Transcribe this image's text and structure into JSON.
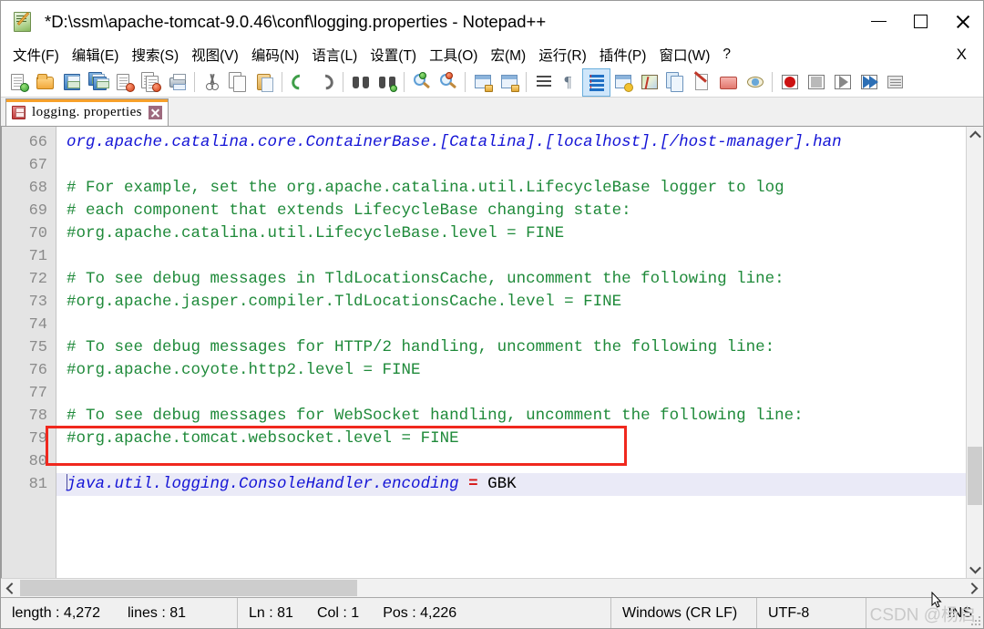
{
  "window": {
    "title": "*D:\\ssm\\apache-tomcat-9.0.46\\conf\\logging.properties - Notepad++",
    "app_icon": "notepad-plus-plus-icon",
    "controls": {
      "minimize": "minimize-icon",
      "maximize": "maximize-icon",
      "close": "close-icon"
    }
  },
  "menubar": {
    "items": [
      {
        "label": "文件(F)",
        "name": "menu-file"
      },
      {
        "label": "编辑(E)",
        "name": "menu-edit"
      },
      {
        "label": "搜索(S)",
        "name": "menu-search"
      },
      {
        "label": "视图(V)",
        "name": "menu-view"
      },
      {
        "label": "编码(N)",
        "name": "menu-encoding"
      },
      {
        "label": "语言(L)",
        "name": "menu-language"
      },
      {
        "label": "设置(T)",
        "name": "menu-settings"
      },
      {
        "label": "工具(O)",
        "name": "menu-tools"
      },
      {
        "label": "宏(M)",
        "name": "menu-macro"
      },
      {
        "label": "运行(R)",
        "name": "menu-run"
      },
      {
        "label": "插件(P)",
        "name": "menu-plugins"
      },
      {
        "label": "窗口(W)",
        "name": "menu-window"
      },
      {
        "label": "?",
        "name": "menu-help"
      }
    ],
    "close_doc_label": "X"
  },
  "toolbar": {
    "buttons": [
      "new-file-icon",
      "open-file-icon",
      "save-icon",
      "save-all-icon",
      "close-file-icon",
      "close-all-files-icon",
      "print-icon",
      "cut-icon",
      "copy-icon",
      "paste-icon",
      "undo-icon",
      "redo-icon",
      "find-icon",
      "replace-icon",
      "zoom-in-icon",
      "zoom-out-icon",
      "sync-vertical-scroll-icon",
      "sync-horizontal-scroll-icon",
      "word-wrap-icon",
      "show-all-characters-icon",
      "indent-guide-icon",
      "user-defined-language-icon",
      "document-map-icon",
      "function-list-icon",
      "folder-as-workspace-icon",
      "monitoring-icon",
      "macro-record-icon",
      "macro-stop-icon",
      "macro-play-icon",
      "macro-run-multiple-icon",
      "run-icon"
    ]
  },
  "tab": {
    "label": "logging. properties",
    "save_state_icon": "unsaved-floppy-icon",
    "close_icon": "tab-close-icon"
  },
  "editor": {
    "first_line": 66,
    "lines": [
      {
        "no": 66,
        "type": "key",
        "text": "org.apache.catalina.core.ContainerBase.[Catalina].[localhost].[/host-manager].han"
      },
      {
        "no": 67,
        "type": "blank",
        "text": ""
      },
      {
        "no": 68,
        "type": "comment",
        "text": "# For example, set the org.apache.catalina.util.LifecycleBase logger to log"
      },
      {
        "no": 69,
        "type": "comment",
        "text": "# each component that extends LifecycleBase changing state:"
      },
      {
        "no": 70,
        "type": "comment",
        "text": "#org.apache.catalina.util.LifecycleBase.level = FINE"
      },
      {
        "no": 71,
        "type": "blank",
        "text": ""
      },
      {
        "no": 72,
        "type": "comment",
        "text": "# To see debug messages in TldLocationsCache, uncomment the following line:"
      },
      {
        "no": 73,
        "type": "comment",
        "text": "#org.apache.jasper.compiler.TldLocationsCache.level = FINE"
      },
      {
        "no": 74,
        "type": "blank",
        "text": ""
      },
      {
        "no": 75,
        "type": "comment",
        "text": "# To see debug messages for HTTP/2 handling, uncomment the following line:"
      },
      {
        "no": 76,
        "type": "comment",
        "text": "#org.apache.coyote.http2.level = FINE"
      },
      {
        "no": 77,
        "type": "blank",
        "text": ""
      },
      {
        "no": 78,
        "type": "comment",
        "text": "# To see debug messages for WebSocket handling, uncomment the following line:"
      },
      {
        "no": 79,
        "type": "comment",
        "text": "#org.apache.tomcat.websocket.level = FINE"
      },
      {
        "no": 80,
        "type": "blank",
        "text": ""
      },
      {
        "no": 81,
        "type": "current",
        "text": "java.util.logging.ConsoleHandler.encoding = GBK"
      }
    ],
    "current_line": {
      "key": "java.util.logging.ConsoleHandler.encoding",
      "equals": " = ",
      "value": "GBK"
    },
    "annotation": {
      "name": "red-highlight-box",
      "color": "#f0281e"
    },
    "colors": {
      "comment": "#1f8a3a",
      "key": "#1414d6",
      "operator": "#d61414",
      "value": "#000000",
      "current_line_bg": "#eaeaf7",
      "gutter_bg": "#e4e4e4"
    }
  },
  "statusbar": {
    "length_label": "length : 4,272",
    "lines_label": "lines : 81",
    "ln_label": "Ln : 81",
    "col_label": "Col : 1",
    "pos_label": "Pos : 4,226",
    "eol_label": "Windows (CR LF)",
    "encoding_label": "UTF-8",
    "insert_mode_label": "INS"
  },
  "watermark": {
    "text": "CSDN @杨启"
  }
}
